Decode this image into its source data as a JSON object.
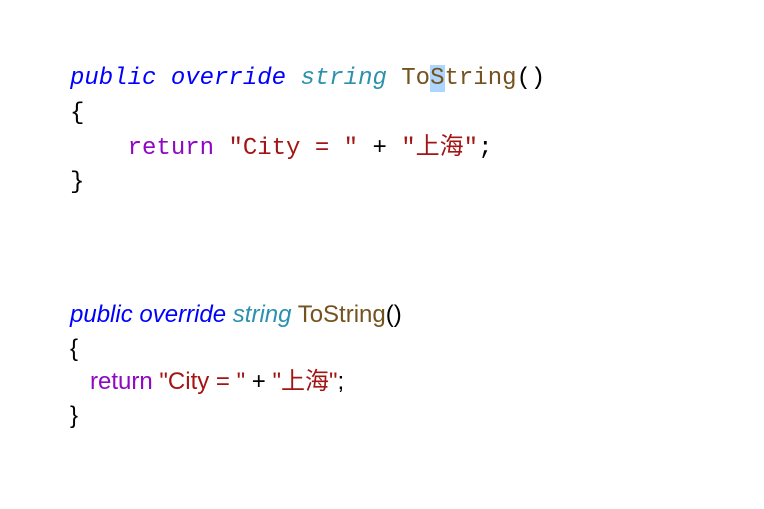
{
  "block1": {
    "kw_public": "public",
    "kw_override": "override",
    "cls_string": "string",
    "method_name_pre": "To",
    "method_name_highlight": "S",
    "method_name_post": "tring",
    "paren": "()",
    "brace_open": "{",
    "kw_return": "return",
    "str1": "\"City = \"",
    "op_plus": "+",
    "str2": "\"上海\"",
    "semicolon": ";",
    "brace_close": "}"
  },
  "block2": {
    "kw_public": "public",
    "kw_override": "override",
    "cls_string": "string",
    "method_name": "ToString",
    "paren": "()",
    "brace_open": "{",
    "kw_return": "return",
    "str1": "\"City = \"",
    "op_plus": "+",
    "str2": "\"上海\"",
    "semicolon": ";",
    "brace_close": "}"
  }
}
